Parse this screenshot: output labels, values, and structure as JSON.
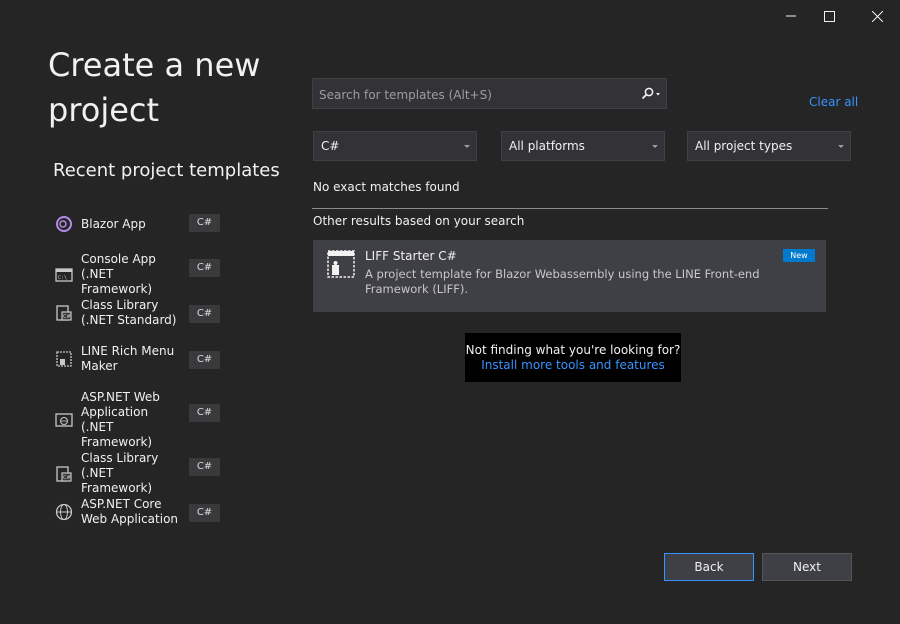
{
  "window": {
    "controls": [
      {
        "name": "minimize-icon"
      },
      {
        "name": "maximize-icon"
      },
      {
        "name": "close-icon"
      }
    ]
  },
  "page": {
    "title": "Create a new project"
  },
  "recent": {
    "title": "Recent project templates",
    "items": [
      {
        "label": "Blazor App",
        "lang": "C#",
        "icon": "blazor-icon"
      },
      {
        "label": "Console App (.NET Framework)",
        "lang": "C#",
        "icon": "console-app-icon"
      },
      {
        "label": "Class Library (.NET Standard)",
        "lang": "C#",
        "icon": "class-library-icon"
      },
      {
        "label": "LINE Rich Menu Maker",
        "lang": "C#",
        "icon": "line-rich-menu-icon"
      },
      {
        "label": "ASP.NET Web Application (.NET Framework)",
        "lang": "C#",
        "icon": "web-application-icon"
      },
      {
        "label": "Class Library (.NET Framework)",
        "lang": "C#",
        "icon": "class-library-icon"
      },
      {
        "label": "ASP.NET Core Web Application",
        "lang": "C#",
        "icon": "globe-icon"
      }
    ]
  },
  "search": {
    "placeholder": "Search for templates (Alt+S)",
    "value": ""
  },
  "filters": {
    "clear_all": "Clear all",
    "language": "C#",
    "platform": "All platforms",
    "project_type": "All project types"
  },
  "results": {
    "no_match": "No exact matches found",
    "other_results": "Other results based on your search",
    "items": [
      {
        "title": "LIFF Starter C#",
        "description": "A project template for Blazor Webassembly using the LINE Front-end Framework (LIFF).",
        "badge": "New",
        "icon": "template-icon"
      }
    ]
  },
  "help": {
    "question": "Not finding what you're looking for?",
    "link": "Install more tools and features"
  },
  "buttons": {
    "back": "Back",
    "next": "Next"
  },
  "colors": {
    "background": "#252526",
    "accent": "#3794ff",
    "badge": "#007acc",
    "card": "#3f3f46"
  }
}
